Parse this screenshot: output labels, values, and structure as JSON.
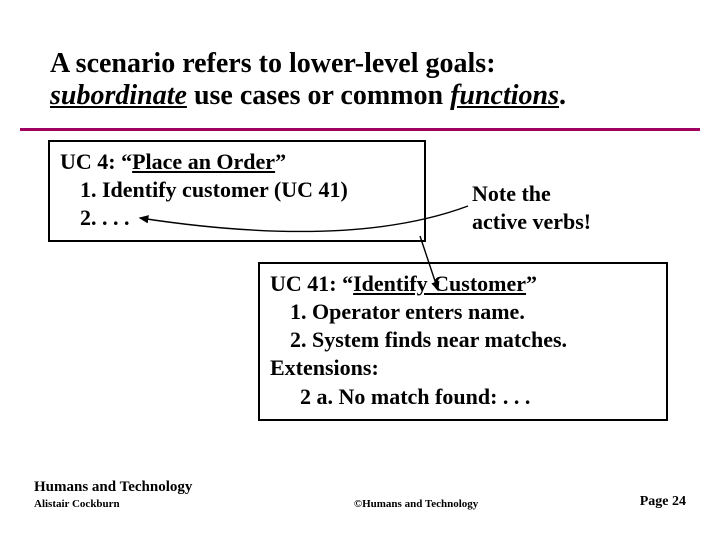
{
  "title": {
    "line1_prefix": "A scenario refers to lower-level goals:",
    "line2_italic1": "subordinate",
    "line2_mid": " use cases or common ",
    "line2_italic2": "functions",
    "line2_suffix": "."
  },
  "box1": {
    "header_prefix": "UC 4:  “",
    "header_title": "Place an Order",
    "header_suffix": "”",
    "step1": "1. Identify customer (UC 41)",
    "step2": "2. . . ."
  },
  "note": {
    "line1": "Note the",
    "line2": "active verbs!"
  },
  "box2": {
    "header_prefix": "UC 41:  “",
    "header_title": "Identify Customer",
    "header_suffix": "”",
    "step1": "1. Operator enters name.",
    "step2": "2. System finds near matches.",
    "ext_label": "Extensions:",
    "ext1": "2 a.  No match found: . . ."
  },
  "footer": {
    "org": "Humans and Technology",
    "author": "Alistair Cockburn",
    "copyright": "©Humans and Technology",
    "page": "Page 24"
  }
}
